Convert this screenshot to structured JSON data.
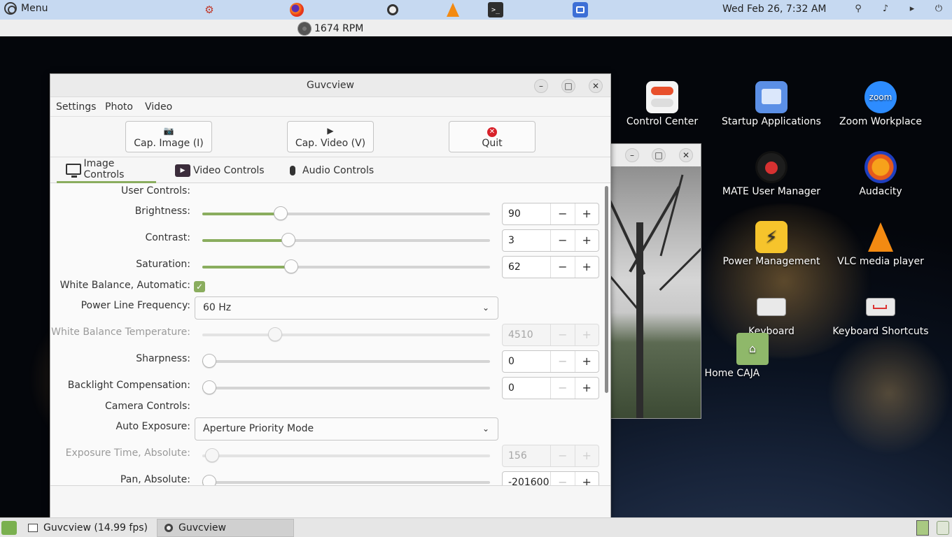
{
  "top_panel": {
    "menu_label": "Menu",
    "clock": "Wed Feb 26,  7:32 AM",
    "launchers": [
      "hardinfo-icon",
      "firefox-icon",
      "webcam-icon",
      "vlc-icon",
      "terminal-icon",
      "window-switcher-icon"
    ],
    "tray": [
      "network-icon",
      "notification-bell-icon",
      "volume-icon",
      "power-icon"
    ]
  },
  "sub_panel": {
    "fan_speed": "1674 RPM"
  },
  "taskbar": {
    "tasks": [
      {
        "label": "Guvcview  (14.99 fps)"
      },
      {
        "label": "Guvcview"
      }
    ]
  },
  "desktop_icons": [
    {
      "label": "Control Center"
    },
    {
      "label": "Startup Applications"
    },
    {
      "label": "Zoom Workplace",
      "badge": "zoom"
    },
    {
      "label": "MATE User Manager"
    },
    {
      "label": "Audacity"
    },
    {
      "label": "Power Management"
    },
    {
      "label": "VLC media player"
    },
    {
      "label": "Keyboard"
    },
    {
      "label": "Keyboard Shortcuts"
    },
    {
      "label": "s Home CAJA"
    }
  ],
  "window": {
    "title": "Guvcview",
    "menu": {
      "settings": "Settings",
      "photo": "Photo",
      "video": "Video"
    },
    "toolbar": {
      "cap_image": "Cap. Image (I)",
      "cap_video": "Cap. Video (V)",
      "quit": "Quit"
    },
    "tabs": {
      "image": "Image Controls",
      "video": "Video Controls",
      "audio": "Audio Controls"
    },
    "controls": {
      "user_controls": "User Controls:",
      "brightness": {
        "label": "Brightness:",
        "value": "90",
        "level": 0.26
      },
      "contrast": {
        "label": "Contrast:",
        "value": "3",
        "level": 0.29
      },
      "saturation": {
        "label": "Saturation:",
        "value": "62",
        "level": 0.3
      },
      "white_balance_auto": {
        "label": "White Balance, Automatic:",
        "checked": true
      },
      "power_line": {
        "label": "Power Line Frequency:",
        "value": "60 Hz"
      },
      "wb_temperature": {
        "label": "White Balance Temperature:",
        "value": "4510",
        "level": 0.24
      },
      "sharpness": {
        "label": "Sharpness:",
        "value": "0",
        "level": 0.0
      },
      "backlight": {
        "label": "Backlight Compensation:",
        "value": "0",
        "level": 0.0
      },
      "camera_controls": "Camera Controls:",
      "auto_exposure": {
        "label": "Auto Exposure:",
        "value": "Aperture Priority Mode"
      },
      "exposure_time": {
        "label": "Exposure Time, Absolute:",
        "value": "156",
        "level": 0.01
      },
      "pan": {
        "label": "Pan, Absolute:",
        "value": "-201600",
        "level": 0.0
      }
    }
  },
  "colors": {
    "accent": "#8aad5e",
    "top_panel": "#c6d9f1",
    "quit_red": "#d8212a"
  }
}
